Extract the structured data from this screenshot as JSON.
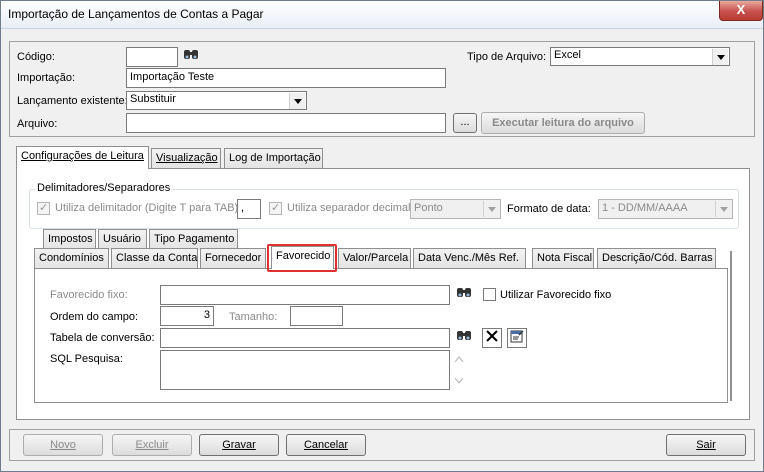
{
  "window": {
    "title": "Importação de Lançamentos de Contas a Pagar",
    "close_symbol": "X"
  },
  "header": {
    "codigo_label": "Código:",
    "codigo_value": "",
    "tipo_arquivo_label": "Tipo de Arquivo:",
    "tipo_arquivo_value": "Excel",
    "importacao_label": "Importação:",
    "importacao_value": "Importação Teste",
    "lancamento_label": "Lançamento existente:",
    "lancamento_value": "Substituir",
    "arquivo_label": "Arquivo:",
    "arquivo_value": "",
    "browse_label": "...",
    "executar_label": "Executar leitura do arquivo"
  },
  "main_tabs": [
    {
      "label": "Configurações de Leitura"
    },
    {
      "label": "Visualização"
    },
    {
      "label": "Log de Importação"
    }
  ],
  "delimiters": {
    "group_title": "Delimitadores/Separadores",
    "utiliza_delimitador_label": "Utiliza delimitador (Digite T para TAB)",
    "delimitador_value": ",",
    "utiliza_separador_label": "Utiliza separador decimal",
    "separador_value": "Ponto",
    "formato_data_label": "Formato de data:",
    "formato_data_value": "1 - DD/MM/AAAA"
  },
  "sub_tabs_row1": [
    {
      "label": "Impostos"
    },
    {
      "label": "Usuário"
    },
    {
      "label": "Tipo Pagamento"
    }
  ],
  "sub_tabs_row2": [
    {
      "label": "Condomínios"
    },
    {
      "label": "Classe da Conta"
    },
    {
      "label": "Fornecedor"
    },
    {
      "label": "Favorecido"
    },
    {
      "label": "Valor/Parcela"
    },
    {
      "label": "Data Venc./Mês Ref."
    },
    {
      "label": "Nota Fiscal"
    },
    {
      "label": "Descrição/Cód. Barras"
    }
  ],
  "favorecido": {
    "fixo_label": "Favorecido fixo:",
    "fixo_value": "",
    "utilizar_fixo_label": "Utilizar Favorecido fixo",
    "ordem_label": "Ordem do campo:",
    "ordem_value": "3",
    "tamanho_label": "Tamanho:",
    "tamanho_value": "",
    "tabela_label": "Tabela de conversão:",
    "tabela_value": "",
    "sql_label": "SQL Pesquisa:",
    "sql_value": ""
  },
  "footer": {
    "novo": "Novo",
    "excluir": "Excluir",
    "gravar": "Gravar",
    "cancelar": "Cancelar",
    "sair": "Sair"
  },
  "icons": {
    "search": "binoculars-icon",
    "clear": "x-icon",
    "edit": "form-edit-icon"
  }
}
